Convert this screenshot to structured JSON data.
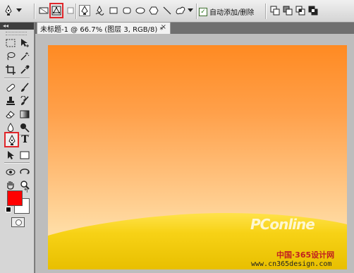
{
  "options_bar": {
    "auto_add_delete": {
      "label": "自动添加/删除",
      "checked": true,
      "check_mark": "✓"
    }
  },
  "toolbox": {
    "collapse_glyph": "◂◂",
    "colors": {
      "foreground": "#ff0000",
      "background": "#ffffff"
    },
    "type_tool_glyph": "T"
  },
  "document": {
    "tab_title": "未标题-1 @ 66.7% (图层 3, RGB/8) *",
    "close_glyph": "×"
  },
  "watermark": {
    "brand": "PConline",
    "cn_line": "中国·365设计网",
    "url": "www.cn365design.com"
  }
}
